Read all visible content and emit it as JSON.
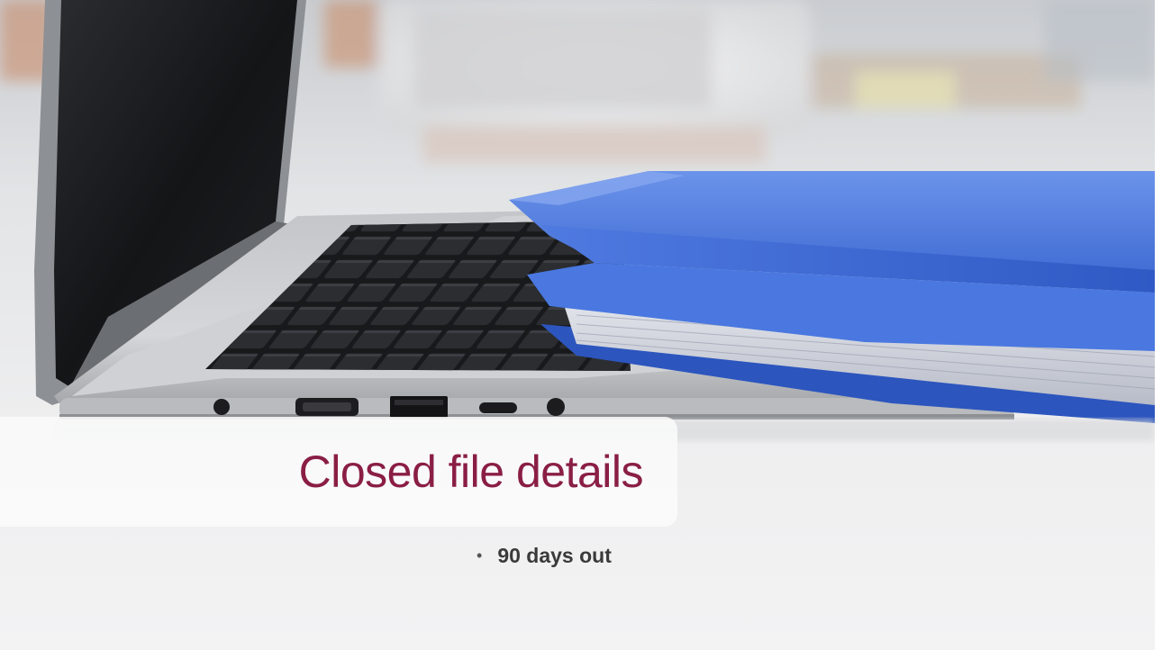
{
  "slide": {
    "title": "Closed file details",
    "bullets": [
      {
        "text": "90 days out"
      }
    ],
    "bullet_symbol": "•"
  },
  "colors": {
    "title": "#8a1e44",
    "bullet_text": "#3a3a3a",
    "folder_blue": "#3f6fd8",
    "panel": "#fafafa"
  },
  "image": {
    "subject": "laptop-and-blue-folders-photo"
  }
}
